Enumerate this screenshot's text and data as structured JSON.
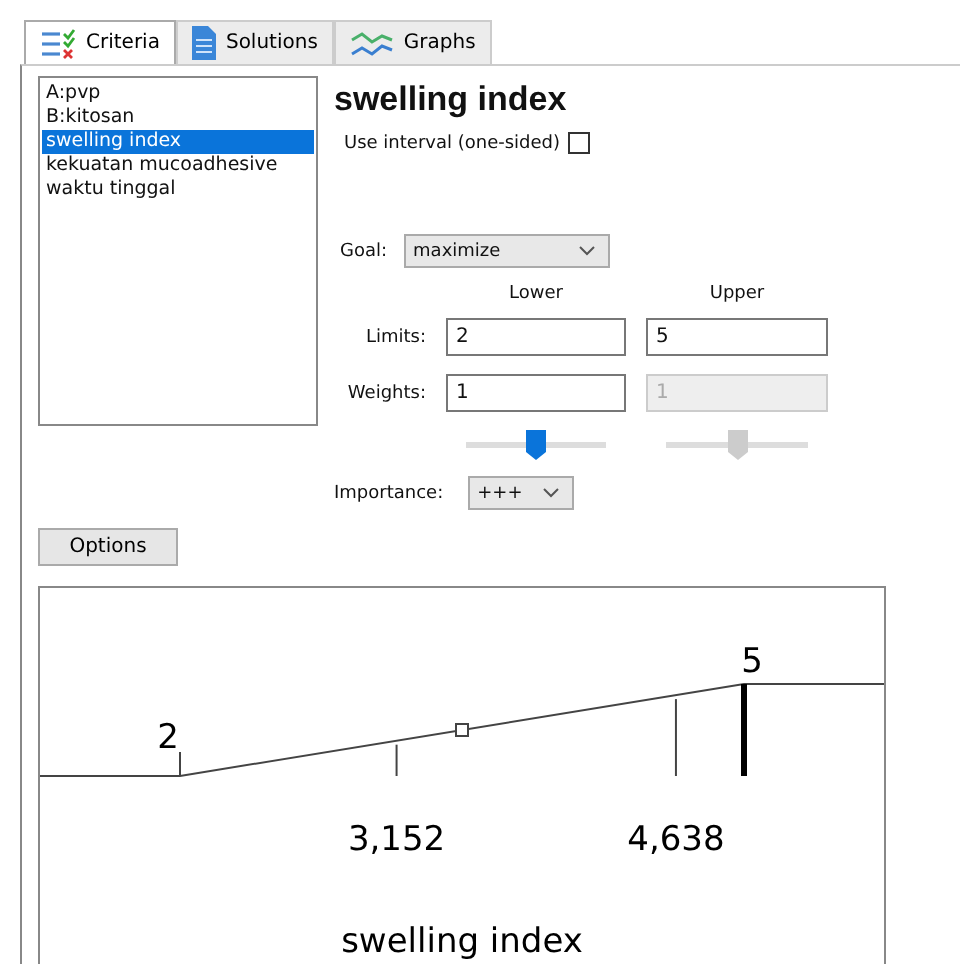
{
  "tabs": [
    {
      "label": "Criteria",
      "selected": true
    },
    {
      "label": "Solutions",
      "selected": false
    },
    {
      "label": "Graphs",
      "selected": false
    }
  ],
  "criteria_list": [
    {
      "label": "A:pvp",
      "selected": false
    },
    {
      "label": "B:kitosan",
      "selected": false
    },
    {
      "label": "swelling index",
      "selected": true
    },
    {
      "label": "kekuatan mucoadhesive",
      "selected": false
    },
    {
      "label": "waktu tinggal",
      "selected": false
    }
  ],
  "title": "swelling index",
  "use_interval": {
    "label": "Use interval (one-sided)",
    "checked": false
  },
  "goal": {
    "label": "Goal:",
    "value": "maximize"
  },
  "columns": [
    "Lower",
    "Upper"
  ],
  "limits": {
    "label": "Limits:",
    "lower": "2",
    "upper": "5"
  },
  "weights": {
    "label": "Weights:",
    "lower": {
      "value": "1",
      "disabled": false,
      "level": 0.5
    },
    "upper": {
      "value": "1",
      "disabled": true,
      "level": 0.5
    }
  },
  "options_button": "Options",
  "importance": {
    "label": "Importance:",
    "value": "+++"
  },
  "ramp": {
    "low": "2",
    "high": "5",
    "points": [
      "3,152",
      "4,638"
    ],
    "axis_title": "swelling index"
  }
}
